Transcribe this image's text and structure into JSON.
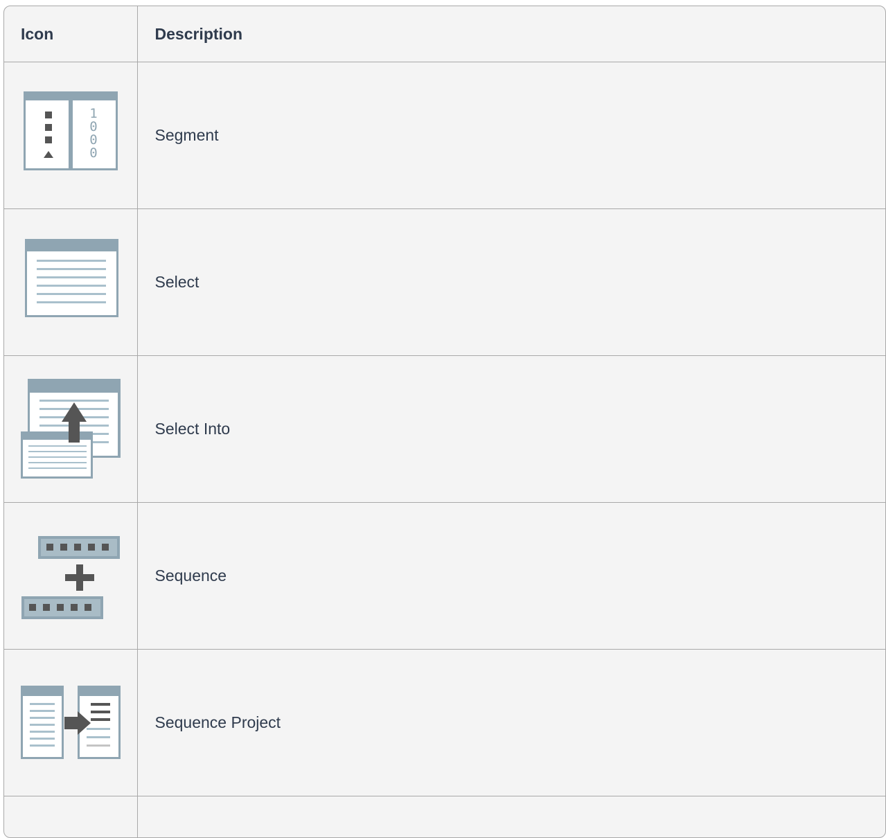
{
  "table": {
    "headers": {
      "icon": "Icon",
      "description": "Description"
    },
    "rows": [
      {
        "icon": "segment-icon",
        "description": "Segment"
      },
      {
        "icon": "select-icon",
        "description": "Select"
      },
      {
        "icon": "select-into-icon",
        "description": "Select Into"
      },
      {
        "icon": "sequence-icon",
        "description": "Sequence"
      },
      {
        "icon": "sequence-project-icon",
        "description": "Sequence Project"
      }
    ]
  },
  "colors": {
    "frame": "#8fa5b2",
    "panel": "#ffffff",
    "dark": "#555555",
    "line": "#a9c0cc",
    "text": "#2f3b4d",
    "border": "#a8a8a8",
    "background": "#f4f4f4"
  }
}
